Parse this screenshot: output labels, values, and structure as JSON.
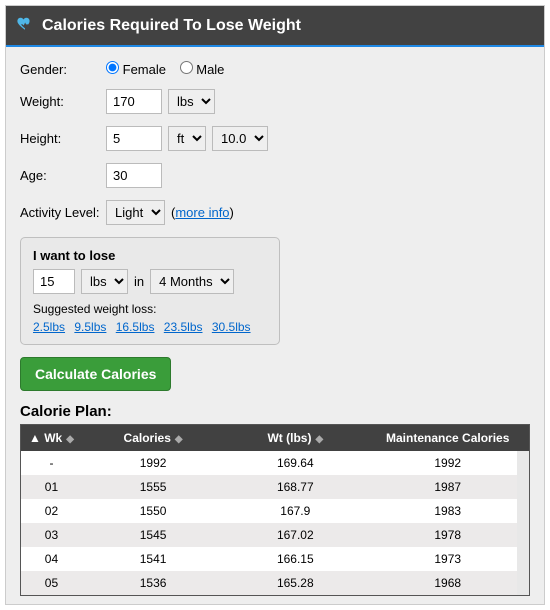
{
  "title": "Calories Required To Lose Weight",
  "form": {
    "gender_label": "Gender:",
    "gender_female": "Female",
    "gender_male": "Male",
    "gender_selected": "Female",
    "weight_label": "Weight:",
    "weight_value": "170",
    "weight_unit": "lbs",
    "height_label": "Height:",
    "height_ft_value": "5",
    "height_ft_unit": "ft",
    "height_in_value": "10.0",
    "age_label": "Age:",
    "age_value": "30",
    "activity_label": "Activity Level:",
    "activity_value": "Light",
    "more_info_prefix": "(",
    "more_info": "more info",
    "more_info_suffix": ")"
  },
  "goal": {
    "heading": "I want to lose",
    "amount_value": "15",
    "amount_unit": "lbs",
    "in_word": "in",
    "duration_value": "4 Months",
    "suggested_label": "Suggested weight loss:",
    "suggested": [
      "2.5lbs",
      "9.5lbs",
      "16.5lbs",
      "23.5lbs",
      "30.5lbs"
    ]
  },
  "calc_button": "Calculate Calories",
  "plan_title": "Calorie Plan:",
  "table": {
    "headers": {
      "wk": "Wk",
      "cal": "Calories",
      "wt": "Wt (lbs)",
      "maint": "Maintenance Calories"
    },
    "rows": [
      {
        "wk": "-",
        "cal": "1992",
        "wt": "169.64",
        "maint": "1992"
      },
      {
        "wk": "01",
        "cal": "1555",
        "wt": "168.77",
        "maint": "1987"
      },
      {
        "wk": "02",
        "cal": "1550",
        "wt": "167.9",
        "maint": "1983"
      },
      {
        "wk": "03",
        "cal": "1545",
        "wt": "167.02",
        "maint": "1978"
      },
      {
        "wk": "04",
        "cal": "1541",
        "wt": "166.15",
        "maint": "1973"
      },
      {
        "wk": "05",
        "cal": "1536",
        "wt": "165.28",
        "maint": "1968"
      }
    ]
  }
}
